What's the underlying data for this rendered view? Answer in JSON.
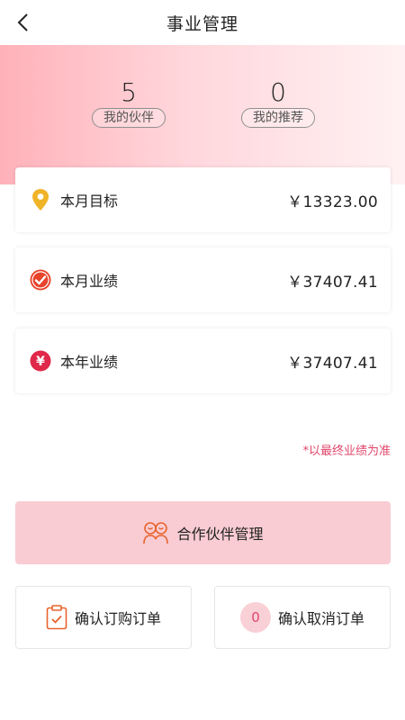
{
  "nav": {
    "title": "事业管理"
  },
  "stats": {
    "partners": {
      "value": "5",
      "label": "我的伙伴"
    },
    "recommend": {
      "value": "0",
      "label": "我的推荐"
    }
  },
  "cards": [
    {
      "label": "本月目标",
      "amount": "￥13323.00",
      "icon": "location-pin-icon"
    },
    {
      "label": "本月业绩",
      "amount": "￥37407.41",
      "icon": "check-circle-icon"
    },
    {
      "label": "本年业绩",
      "amount": "￥37407.41",
      "icon": "yen-circle-icon"
    }
  ],
  "note": "*以最终业绩为准",
  "actions": {
    "partner_manage": "合作伙伴管理",
    "confirm_order": "确认订购订单",
    "confirm_cancel": "确认取消订单",
    "cancel_count": "0"
  },
  "colors": {
    "accent": "#e0466a",
    "pin": "#f0b429",
    "check": "#e8442c",
    "yen": "#e0284a",
    "button_bg": "#f9ccd3"
  }
}
